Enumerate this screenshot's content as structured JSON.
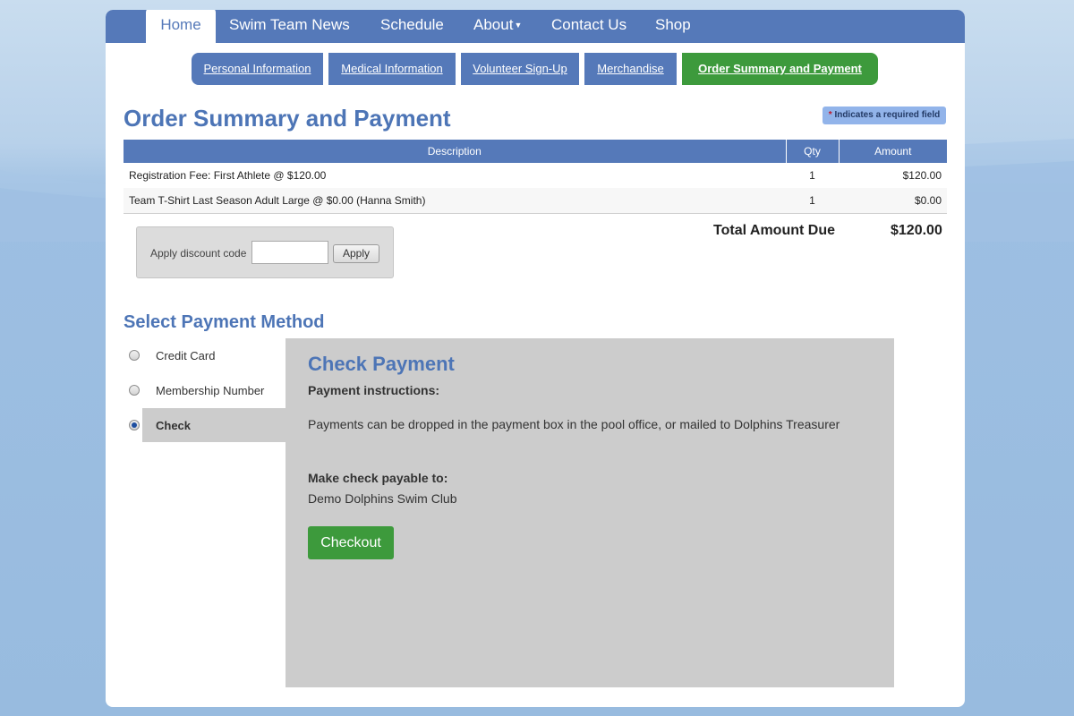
{
  "nav": {
    "items": [
      "Home",
      "Swim Team News",
      "Schedule",
      "About",
      "Contact Us",
      "Shop"
    ]
  },
  "subtabs": [
    "Personal Information",
    "Medical Information",
    "Volunteer Sign-Up",
    "Merchandise",
    "Order Summary and Payment"
  ],
  "page": {
    "title": "Order Summary and Payment",
    "required_star": "*",
    "required_note": "Indicates a required field"
  },
  "order": {
    "headers": {
      "description": "Description",
      "qty": "Qty",
      "amount": "Amount"
    },
    "rows": [
      {
        "description": "Registration Fee: First Athlete @ $120.00",
        "qty": "1",
        "amount": "$120.00"
      },
      {
        "description": "Team T-Shirt Last Season Adult Large @ $0.00 (Hanna Smith)",
        "qty": "1",
        "amount": "$0.00"
      }
    ],
    "total_label": "Total Amount Due",
    "total_value": "$120.00"
  },
  "discount": {
    "label": "Apply discount code",
    "value": "",
    "apply_label": "Apply"
  },
  "payment": {
    "section_title": "Select Payment Method",
    "methods": [
      {
        "label": "Credit Card",
        "selected": false
      },
      {
        "label": "Membership Number",
        "selected": false
      },
      {
        "label": "Check",
        "selected": true
      }
    ],
    "panel": {
      "title": "Check Payment",
      "instructions_heading": "Payment instructions:",
      "instructions": "Payments can be dropped in the payment box in the pool office, or mailed to Dolphins Treasurer",
      "payable_heading": "Make check payable to:",
      "payable_to": "Demo Dolphins Swim Club",
      "checkout_label": "Checkout"
    }
  },
  "colors": {
    "primary_blue": "#5579b9",
    "title_blue": "#4d75b6",
    "accent_green": "#3d9a3c",
    "panel_gray": "#cccccc"
  }
}
